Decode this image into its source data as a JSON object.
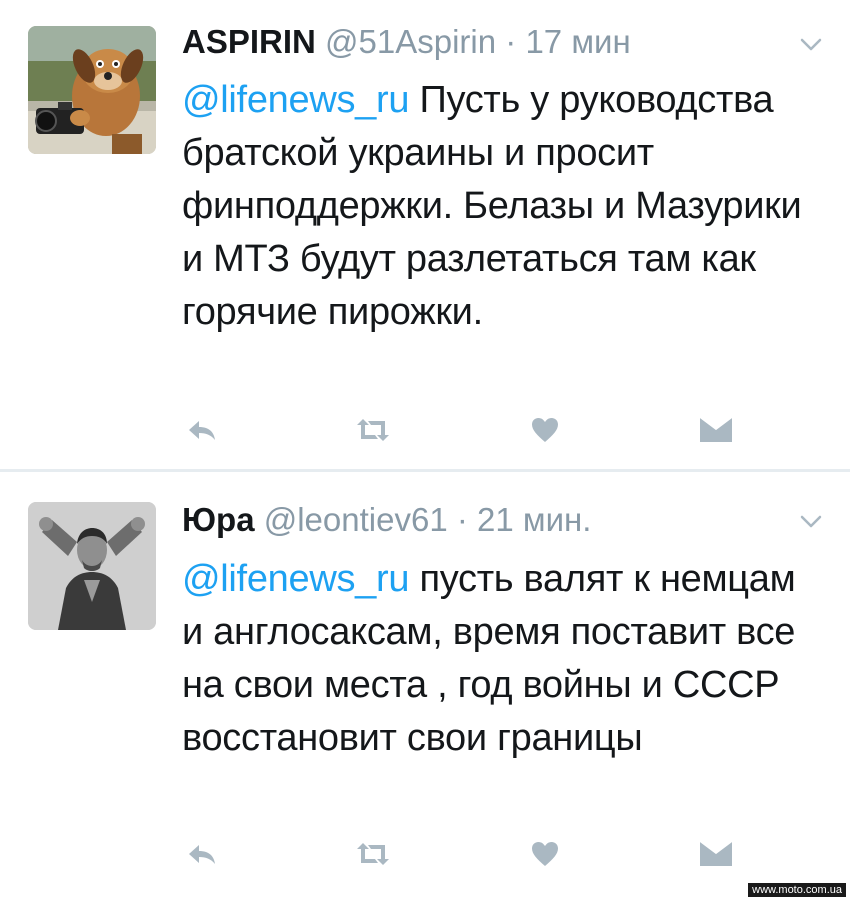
{
  "tweets": [
    {
      "display_name": "ASPIRIN",
      "handle": "@51Aspirin",
      "separator": "·",
      "time": "17 мин",
      "mention": "@lifenews_ru",
      "text": " Пусть у руководства братской украины и просит финподдержки. Белазы и Мазурики и МТЗ будут разлетаться там как горячие пирожки.",
      "avatar_icon": "cartoon-dog-with-camera",
      "actions": [
        "reply-icon",
        "retweet-icon",
        "like-icon",
        "direct-message-icon"
      ]
    },
    {
      "display_name": "Юра",
      "handle": "@leontiev61",
      "separator": "·",
      "time": "21 мин.",
      "mention": "@lifenews_ru",
      "text": " пусть валят к немцам и англосаксам, время поставит все на свои места , год войны и СССР восстановит свои границы",
      "avatar_icon": "man-portrait-photo",
      "actions": [
        "reply-icon",
        "retweet-icon",
        "like-icon",
        "direct-message-icon"
      ]
    }
  ],
  "watermark": "www.moto.com.ua",
  "colors": {
    "mention": "#1da1f2",
    "muted": "#8899a6",
    "icon": "#aab8c2",
    "text": "#14171a",
    "divider": "#e6ecf0"
  }
}
